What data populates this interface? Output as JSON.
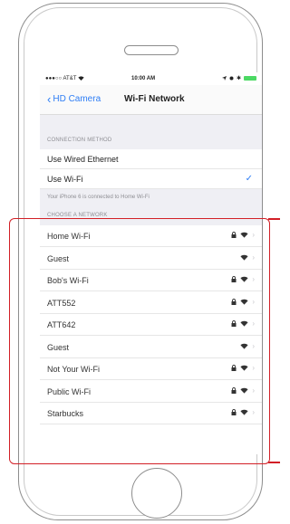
{
  "status_bar": {
    "carrier": "AT&T",
    "time": "10:00 AM",
    "bluetooth_symbol": "✱"
  },
  "nav": {
    "back_label": "HD Camera",
    "title": "Wi-Fi Network"
  },
  "connection": {
    "header": "CONNECTION METHOD",
    "wired_label": "Use Wired Ethernet",
    "wifi_label": "Use Wi-Fi",
    "checkmark": "✓",
    "footnote": "Your iPhone 6 is connected to Home Wi-Fi"
  },
  "networks": {
    "header": "CHOOSE A NETWORK",
    "items": [
      {
        "name": "Home Wi-Fi",
        "secured": true
      },
      {
        "name": "Guest",
        "secured": false
      },
      {
        "name": "Bob's Wi-Fi",
        "secured": true
      },
      {
        "name": "ATT552",
        "secured": true
      },
      {
        "name": "ATT642",
        "secured": true
      },
      {
        "name": "Guest",
        "secured": false
      },
      {
        "name": "Not Your Wi-Fi",
        "secured": true
      },
      {
        "name": "Public Wi-Fi",
        "secured": true
      },
      {
        "name": "Starbucks",
        "secured": true
      }
    ]
  },
  "colors": {
    "accent": "#2f7ef5",
    "highlight": "#d21f26",
    "battery": "#4cd964"
  }
}
